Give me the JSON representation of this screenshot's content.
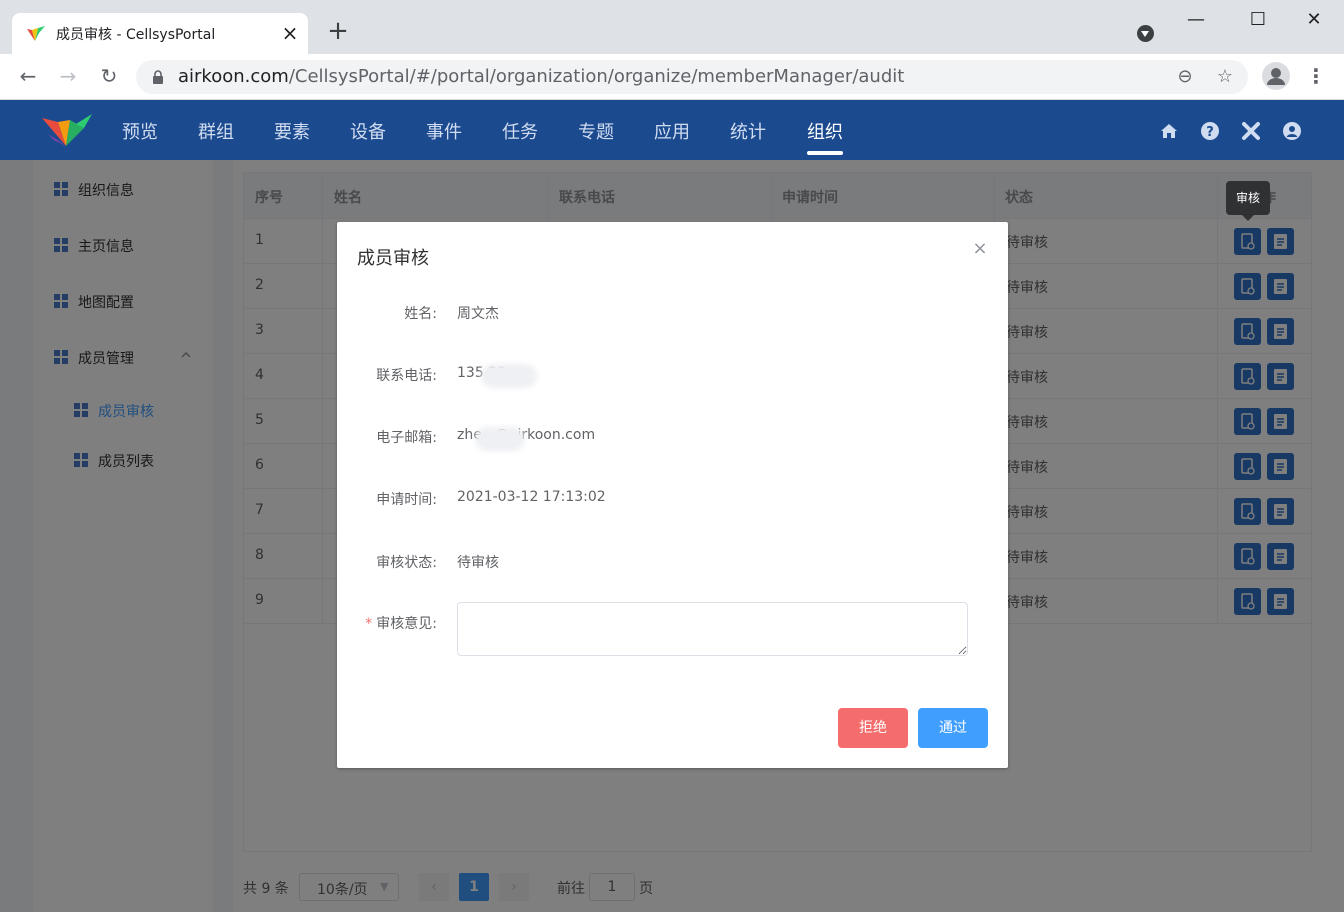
{
  "browser": {
    "tab_title": "成员审核 - CellsysPortal",
    "url_host": "airkoon.com",
    "url_path": "/CellsysPortal/#/portal/organization/organize/memberManager/audit",
    "new_tab_glyph": "+",
    "close_glyph": "×",
    "win_min": "—",
    "win_max": "☐",
    "win_close": "✕",
    "back_glyph": "←",
    "forward_glyph": "→",
    "reload_glyph": "↻",
    "zoom_glyph": "⊖",
    "star_glyph": "☆",
    "menu_glyph": "⋮"
  },
  "header": {
    "nav": [
      "预览",
      "群组",
      "要素",
      "设备",
      "事件",
      "任务",
      "专题",
      "应用",
      "统计",
      "组织"
    ],
    "active_index": 9,
    "accent": "#1c4a8f",
    "icons": [
      "home-icon",
      "help-icon",
      "tools-icon",
      "user-icon"
    ]
  },
  "sidebar": {
    "items": [
      {
        "label": "组织信息"
      },
      {
        "label": "主页信息"
      },
      {
        "label": "地图配置"
      },
      {
        "label": "成员管理"
      },
      {
        "label": "成员审核"
      },
      {
        "label": "成员列表"
      }
    ],
    "active_index": 4
  },
  "table": {
    "headers": [
      "序号",
      "姓名",
      "联系电话",
      "申请时间",
      "状态",
      "操作"
    ],
    "rows": [
      {
        "index": "1",
        "status": "待审核"
      },
      {
        "index": "2",
        "status": "待审核"
      },
      {
        "index": "3",
        "status": "待审核"
      },
      {
        "index": "4",
        "status": "待审核"
      },
      {
        "index": "5",
        "status": "待审核"
      },
      {
        "index": "6",
        "status": "待审核"
      },
      {
        "index": "7",
        "status": "待审核"
      },
      {
        "index": "8",
        "status": "待审核"
      },
      {
        "index": "9",
        "status": "待审核"
      }
    ],
    "op_partial": "作"
  },
  "pagination": {
    "total": "共 9 条",
    "page_size": "10条/页",
    "prev": "‹",
    "next": "›",
    "current_page": "1",
    "goto_label": "前往",
    "goto_value": "1",
    "page_suffix": "页"
  },
  "tooltip": "审核",
  "dialog": {
    "title": "成员审核",
    "close_glyph": "×",
    "fields": [
      {
        "label": "姓名:",
        "value": "周文杰"
      },
      {
        "label": "联系电话:",
        "value": "135          39"
      },
      {
        "label": "电子邮箱:",
        "value": "zhe          e@airkoon.com"
      },
      {
        "label": "申请时间:",
        "value": "2021-03-12 17:13:02"
      },
      {
        "label": "审核状态:",
        "value": "待审核"
      }
    ],
    "opinion_label": "审核意见:",
    "required_mark": "*",
    "opinion_value": "",
    "reject_label": "拒绝",
    "pass_label": "通过",
    "reject_color": "#f56c6c",
    "pass_color": "#409eff"
  }
}
